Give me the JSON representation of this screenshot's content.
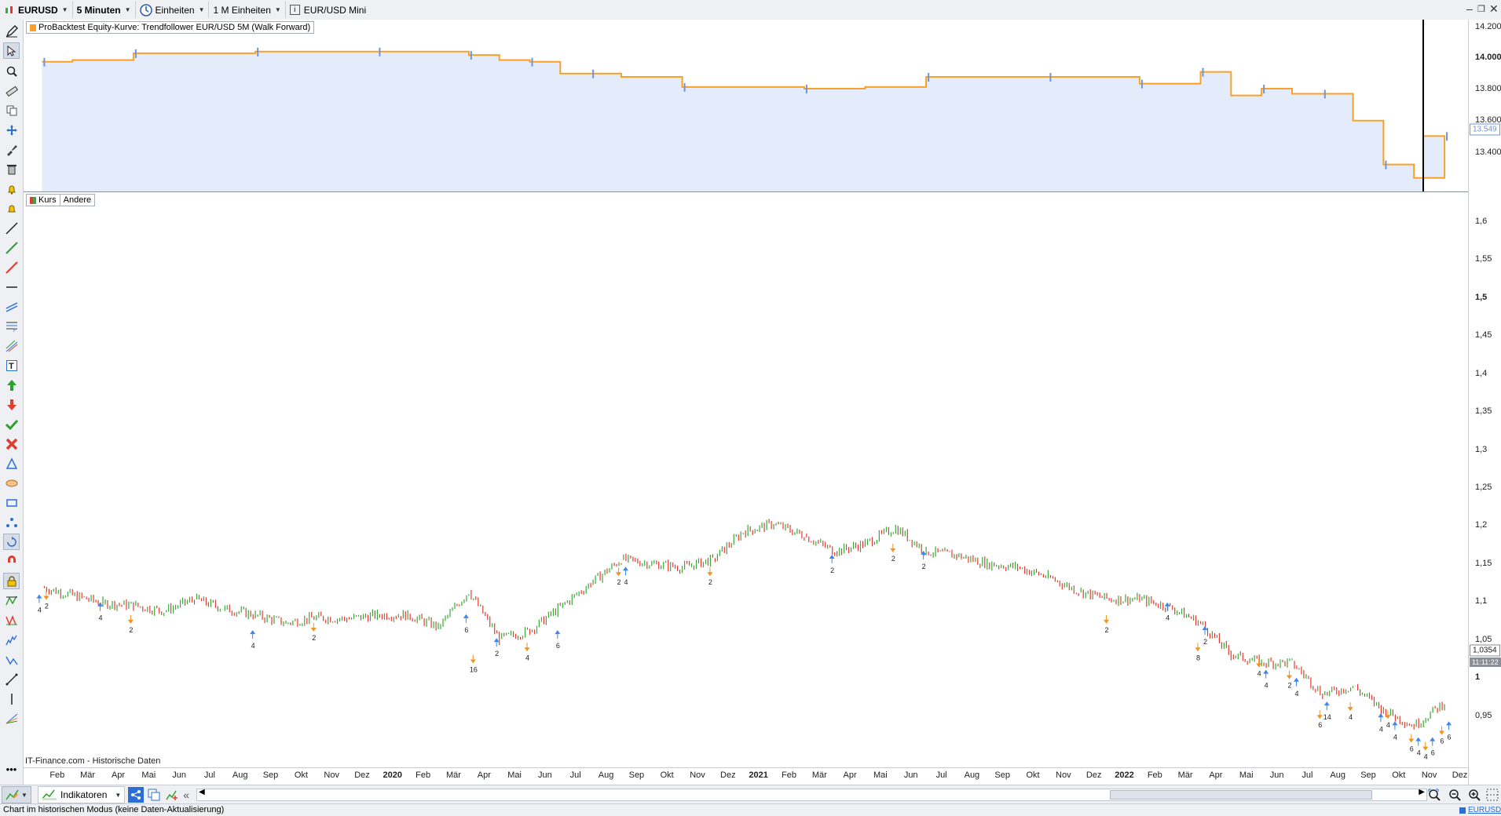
{
  "toolbar": {
    "symbol": "EURUSD",
    "timeframe": "5 Minuten",
    "units_label": "Einheiten",
    "units_count": "1 M Einheiten",
    "instrument": "EUR/USD Mini"
  },
  "equity_panel": {
    "label": "ProBacktest Equity-Kurve: Trendfollower EUR/USD 5M (Walk Forward)",
    "y_ticks": [
      "14.200",
      "14.000",
      "13.800",
      "13.600",
      "13.400"
    ],
    "current_value": "13.549",
    "colors": {
      "line": "#f7a128",
      "fill": "#e4ecfb",
      "spike": "#6f93d8"
    }
  },
  "price_panel": {
    "tabs": [
      "Kurs",
      "Andere"
    ],
    "y_ticks": [
      "1,6",
      "1,55",
      "1,5",
      "1,45",
      "1,4",
      "1,35",
      "1,3",
      "1,25",
      "1,2",
      "1,15",
      "1,1",
      "1,05",
      "1",
      "0,95"
    ],
    "current_price": "1,0354",
    "current_time": "11:11:22",
    "source": "IT-Finance.com - Historische Daten",
    "colors": {
      "up": "#3aa83a",
      "down": "#e03c31",
      "buy_arrow": "#3d86f0",
      "sell_arrow": "#f29420"
    }
  },
  "date_axis": [
    "Feb",
    "Mär",
    "Apr",
    "Mai",
    "Jun",
    "Jul",
    "Aug",
    "Sep",
    "Okt",
    "Nov",
    "Dez",
    "2020",
    "Feb",
    "Mär",
    "Apr",
    "Mai",
    "Jun",
    "Jul",
    "Aug",
    "Sep",
    "Okt",
    "Nov",
    "Dez",
    "2021",
    "Feb",
    "Mär",
    "Apr",
    "Mai",
    "Jun",
    "Jul",
    "Aug",
    "Sep",
    "Okt",
    "Nov",
    "Dez",
    "2022",
    "Feb",
    "Mär",
    "Apr",
    "Mai",
    "Jun",
    "Jul",
    "Aug",
    "Sep",
    "Okt",
    "Nov",
    "Dez"
  ],
  "bottom_bar": {
    "indicators_label": "Indikatoren",
    "symbol_link": "EURUSD"
  },
  "status": "Chart im historischen Modus (keine Daten-Aktualisierung)",
  "chart_data": [
    {
      "type": "area",
      "title": "ProBacktest Equity-Kurve: Trendfollower EUR/USD 5M (Walk Forward)",
      "x": [
        "2019-01",
        "2019-02",
        "2019-04",
        "2019-06",
        "2019-08",
        "2019-10",
        "2019-12",
        "2020-02",
        "2020-03",
        "2020-04",
        "2020-05",
        "2020-06",
        "2020-07",
        "2020-08",
        "2020-10",
        "2020-12",
        "2021-02",
        "2021-04",
        "2021-06",
        "2021-08",
        "2021-10",
        "2021-12",
        "2022-01",
        "2022-02",
        "2022-03",
        "2022-04",
        "2022-05",
        "2022-06",
        "2022-07",
        "2022-08",
        "2022-09",
        "2022-10",
        "2022-11"
      ],
      "values": [
        13990,
        14000,
        14040,
        14040,
        14050,
        14050,
        14050,
        14050,
        14030,
        14000,
        13990,
        13920,
        13920,
        13900,
        13840,
        13840,
        13830,
        13840,
        13900,
        13900,
        13900,
        13900,
        13860,
        13860,
        13930,
        13790,
        13830,
        13800,
        13800,
        13640,
        13380,
        13300,
        13549
      ],
      "ylim": [
        13220,
        14240
      ]
    },
    {
      "type": "line",
      "title": "Kurs",
      "x": [
        "2019-01",
        "2019-02",
        "2019-03",
        "2019-04",
        "2019-05",
        "2019-06",
        "2019-07",
        "2019-08",
        "2019-09",
        "2019-10",
        "2019-11",
        "2019-12",
        "2020-01",
        "2020-02",
        "2020-03",
        "2020-04",
        "2020-05",
        "2020-06",
        "2020-07",
        "2020-08",
        "2020-09",
        "2020-10",
        "2020-11",
        "2020-12",
        "2021-01",
        "2021-02",
        "2021-03",
        "2021-04",
        "2021-05",
        "2021-06",
        "2021-07",
        "2021-08",
        "2021-09",
        "2021-10",
        "2021-11",
        "2021-12",
        "2022-01",
        "2022-02",
        "2022-03",
        "2022-04",
        "2022-05",
        "2022-06",
        "2022-07",
        "2022-08",
        "2022-09",
        "2022-10",
        "2022-11"
      ],
      "values": [
        1.145,
        1.135,
        1.125,
        1.122,
        1.115,
        1.13,
        1.118,
        1.11,
        1.1,
        1.107,
        1.105,
        1.11,
        1.11,
        1.095,
        1.14,
        1.08,
        1.09,
        1.12,
        1.15,
        1.18,
        1.175,
        1.17,
        1.18,
        1.215,
        1.225,
        1.21,
        1.19,
        1.2,
        1.22,
        1.19,
        1.185,
        1.175,
        1.17,
        1.158,
        1.14,
        1.13,
        1.13,
        1.12,
        1.1,
        1.06,
        1.05,
        1.05,
        1.01,
        1.02,
        0.99,
        0.97,
        1.0
      ],
      "ylim": [
        0.92,
        1.64
      ],
      "signals": [
        {
          "x": "2019-01",
          "y": 1.135,
          "dir": "buy",
          "label": "4"
        },
        {
          "x": "2019-01",
          "y": 1.14,
          "dir": "sell",
          "label": "2"
        },
        {
          "x": "2019-03",
          "y": 1.125,
          "dir": "buy",
          "label": "4"
        },
        {
          "x": "2019-04",
          "y": 1.11,
          "dir": "sell",
          "label": "2"
        },
        {
          "x": "2019-08",
          "y": 1.09,
          "dir": "buy",
          "label": "4"
        },
        {
          "x": "2019-10",
          "y": 1.1,
          "dir": "sell",
          "label": "2"
        },
        {
          "x": "2020-03",
          "y": 1.11,
          "dir": "buy",
          "label": "6"
        },
        {
          "x": "2020-03",
          "y": 1.06,
          "dir": "sell",
          "label": "16"
        },
        {
          "x": "2020-04",
          "y": 1.08,
          "dir": "buy",
          "label": "2"
        },
        {
          "x": "2020-05",
          "y": 1.075,
          "dir": "sell",
          "label": "4"
        },
        {
          "x": "2020-06",
          "y": 1.09,
          "dir": "buy",
          "label": "6"
        },
        {
          "x": "2020-08",
          "y": 1.17,
          "dir": "sell",
          "label": "2"
        },
        {
          "x": "2020-08",
          "y": 1.17,
          "dir": "buy",
          "label": "4"
        },
        {
          "x": "2020-11",
          "y": 1.17,
          "dir": "sell",
          "label": "2"
        },
        {
          "x": "2021-03",
          "y": 1.185,
          "dir": "buy",
          "label": "2"
        },
        {
          "x": "2021-05",
          "y": 1.2,
          "dir": "sell",
          "label": "2"
        },
        {
          "x": "2021-06",
          "y": 1.19,
          "dir": "buy",
          "label": "2"
        },
        {
          "x": "2021-12",
          "y": 1.11,
          "dir": "sell",
          "label": "2"
        },
        {
          "x": "2022-02",
          "y": 1.125,
          "dir": "buy",
          "label": "4"
        },
        {
          "x": "2022-03",
          "y": 1.075,
          "dir": "sell",
          "label": "8"
        },
        {
          "x": "2022-03",
          "y": 1.095,
          "dir": "buy",
          "label": "2"
        },
        {
          "x": "2022-05",
          "y": 1.055,
          "dir": "sell",
          "label": "4"
        },
        {
          "x": "2022-05",
          "y": 1.04,
          "dir": "buy",
          "label": "4"
        },
        {
          "x": "2022-06",
          "y": 1.04,
          "dir": "sell",
          "label": "2"
        },
        {
          "x": "2022-06",
          "y": 1.03,
          "dir": "buy",
          "label": "4"
        },
        {
          "x": "2022-07",
          "y": 0.99,
          "dir": "sell",
          "label": "6"
        },
        {
          "x": "2022-07",
          "y": 1.0,
          "dir": "buy",
          "label": "14"
        },
        {
          "x": "2022-08",
          "y": 1.0,
          "dir": "sell",
          "label": "4"
        },
        {
          "x": "2022-09",
          "y": 0.985,
          "dir": "buy",
          "label": "4"
        },
        {
          "x": "2022-09",
          "y": 0.99,
          "dir": "sell",
          "label": "4"
        },
        {
          "x": "2022-09",
          "y": 0.975,
          "dir": "buy",
          "label": "4"
        },
        {
          "x": "2022-10",
          "y": 0.96,
          "dir": "sell",
          "label": "6"
        },
        {
          "x": "2022-10",
          "y": 0.955,
          "dir": "buy",
          "label": "4"
        },
        {
          "x": "2022-10",
          "y": 0.95,
          "dir": "sell",
          "label": "4"
        },
        {
          "x": "2022-10",
          "y": 0.955,
          "dir": "buy",
          "label": "6"
        },
        {
          "x": "2022-11",
          "y": 0.97,
          "dir": "sell",
          "label": "6"
        },
        {
          "x": "2022-11",
          "y": 0.975,
          "dir": "buy",
          "label": "6"
        }
      ]
    }
  ]
}
